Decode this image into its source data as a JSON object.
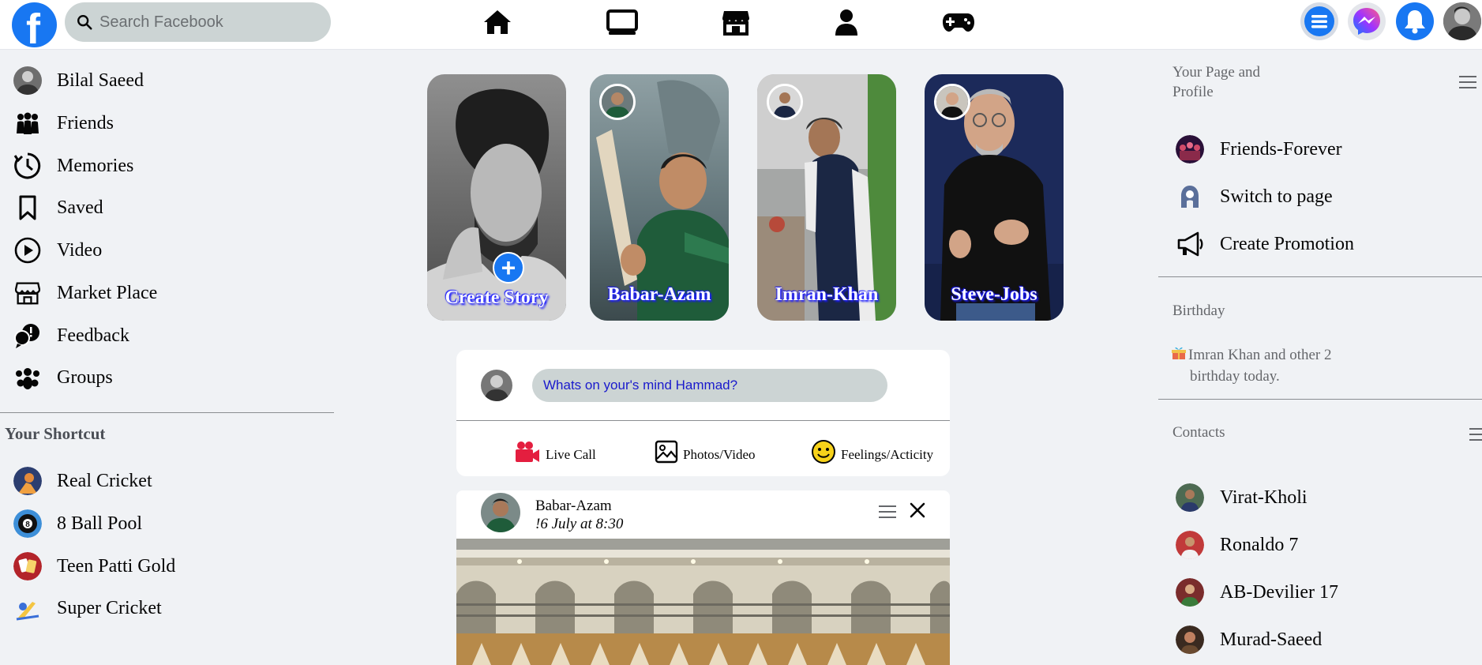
{
  "search": {
    "placeholder": "Search Facebook"
  },
  "nav": {
    "logo_letter": "f",
    "center_icons": [
      "home-icon",
      "watch-icon",
      "marketplace-icon",
      "profile-icon",
      "gaming-icon"
    ],
    "right_icons": [
      "menu-icon",
      "messenger-icon",
      "notifications-icon",
      "account-avatar"
    ]
  },
  "left_sidebar": {
    "items": [
      {
        "label": "Bilal Saeed",
        "icon": "user-avatar"
      },
      {
        "label": "Friends",
        "icon": "friends-icon"
      },
      {
        "label": "Memories",
        "icon": "clock-icon"
      },
      {
        "label": "Saved",
        "icon": "bookmark-icon"
      },
      {
        "label": "Video",
        "icon": "play-icon"
      },
      {
        "label": "Market Place",
        "icon": "store-icon"
      },
      {
        "label": "Feedback",
        "icon": "feedback-icon"
      },
      {
        "label": "Groups",
        "icon": "groups-icon"
      }
    ],
    "shortcut_title": "Your Shortcut",
    "shortcuts": [
      {
        "label": "Real Cricket"
      },
      {
        "label": "8 Ball Pool"
      },
      {
        "label": "Teen Patti Gold"
      },
      {
        "label": "Super Cricket"
      }
    ]
  },
  "stories": [
    {
      "name": "Create Story",
      "type": "create"
    },
    {
      "name": "Babar-Azam"
    },
    {
      "name": "Imran-Khan"
    },
    {
      "name": "Steve-Jobs"
    }
  ],
  "composer": {
    "placeholder": "Whats on your's mind Hammad?",
    "actions": [
      {
        "label": "Live Call",
        "icon": "video-camera-icon"
      },
      {
        "label": "Photos/Video",
        "icon": "image-icon"
      },
      {
        "label": "Feelings/Acticity",
        "icon": "smiley-icon"
      }
    ]
  },
  "post": {
    "author": "Babar-Azam",
    "date": "!6 July at 8:30"
  },
  "right_sidebar": {
    "pages_title_line1": "Your Page and",
    "pages_title_line2": "Profile",
    "pages": [
      {
        "label": "Friends-Forever",
        "icon": "group-page-avatar"
      },
      {
        "label": "Switch to page",
        "icon": "switch-user-icon"
      },
      {
        "label": "Create Promotion",
        "icon": "megaphone-icon"
      }
    ],
    "birthday_title": "Birthday",
    "birthday_line1": "Imran Khan and other 2",
    "birthday_line2": "birthday today.",
    "contacts_title": "Contacts",
    "contacts": [
      {
        "label": "Virat-Kholi"
      },
      {
        "label": "Ronaldo 7"
      },
      {
        "label": "AB-Devilier 17"
      },
      {
        "label": "Murad-Saeed"
      }
    ]
  },
  "colors": {
    "brand": "#1877f2",
    "background": "#f0f2f5",
    "search_bg": "#ccd4d4",
    "live_red": "#e41e3f",
    "smiley_yellow": "#f7d21a"
  }
}
